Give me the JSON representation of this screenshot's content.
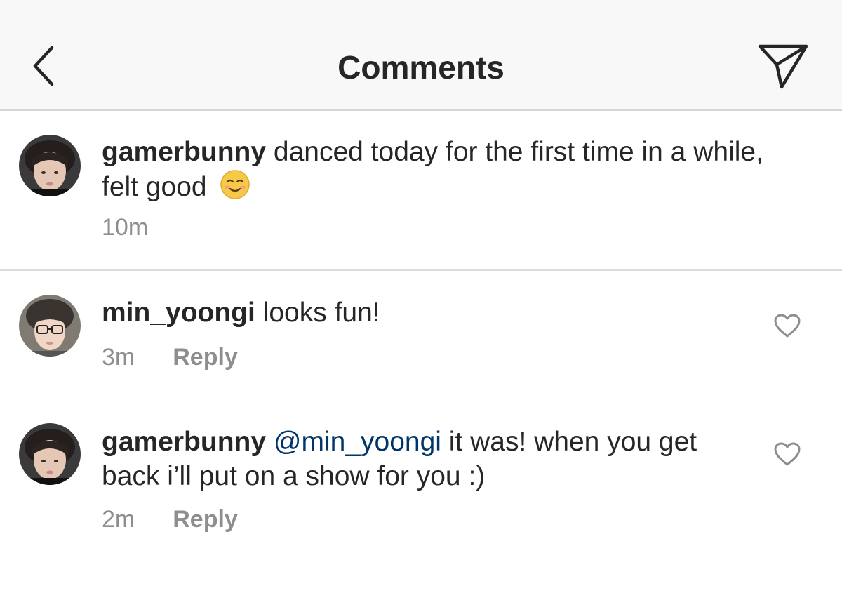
{
  "header": {
    "title": "Comments",
    "back_icon": "chevron-left-icon",
    "send_icon": "paper-plane-icon"
  },
  "caption": {
    "username": "gamerbunny",
    "text_line1": "danced today for the first time in a while,",
    "text_line2": "felt good",
    "emoji": "smiling-face-icon",
    "time": "10m"
  },
  "comments": [
    {
      "username": "min_yoongi",
      "text": "looks fun!",
      "time": "3m",
      "reply_label": "Reply"
    },
    {
      "username": "gamerbunny",
      "mention": "@min_yoongi",
      "text_line1": "it was! when you get",
      "text_line2": "back i’ll put on a show for you :)",
      "time": "2m",
      "reply_label": "Reply"
    }
  ],
  "colors": {
    "header_bg": "#f8f8f8",
    "text": "#262626",
    "secondary": "#8e8e8e",
    "mention": "#003569"
  }
}
